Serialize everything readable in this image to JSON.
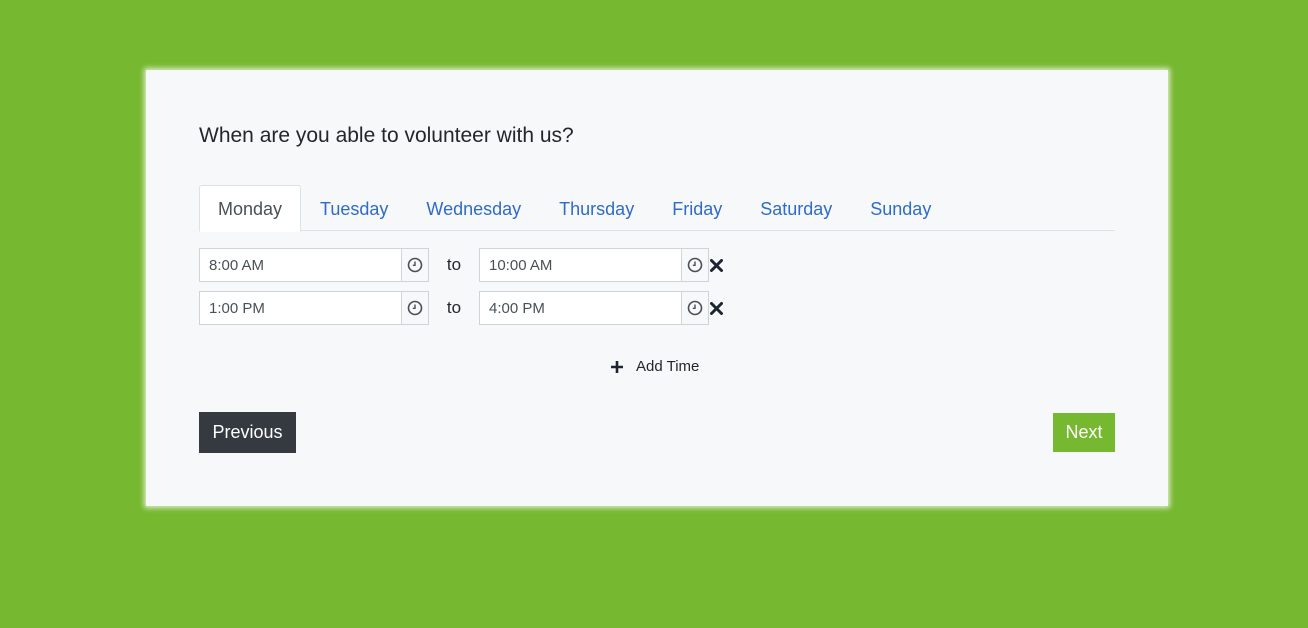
{
  "question": "When are you able to volunteer with us?",
  "tabs": [
    {
      "label": "Monday",
      "active": true
    },
    {
      "label": "Tuesday",
      "active": false
    },
    {
      "label": "Wednesday",
      "active": false
    },
    {
      "label": "Thursday",
      "active": false
    },
    {
      "label": "Friday",
      "active": false
    },
    {
      "label": "Saturday",
      "active": false
    },
    {
      "label": "Sunday",
      "active": false
    }
  ],
  "slots": [
    {
      "start": "8:00 AM",
      "separator": "to",
      "end": "10:00 AM"
    },
    {
      "start": "1:00 PM",
      "separator": "to",
      "end": "4:00 PM"
    }
  ],
  "icons": {
    "clock": "clock-icon",
    "remove": "close-icon",
    "add": "plus-icon"
  },
  "add_time_label": "Add Time",
  "buttons": {
    "previous": "Previous",
    "next": "Next"
  },
  "colors": {
    "background": "#76b82f",
    "card": "#f7f8fa",
    "tab_link": "#2f6bc8",
    "previous_button": "#343a40",
    "next_button": "#76b82f"
  }
}
